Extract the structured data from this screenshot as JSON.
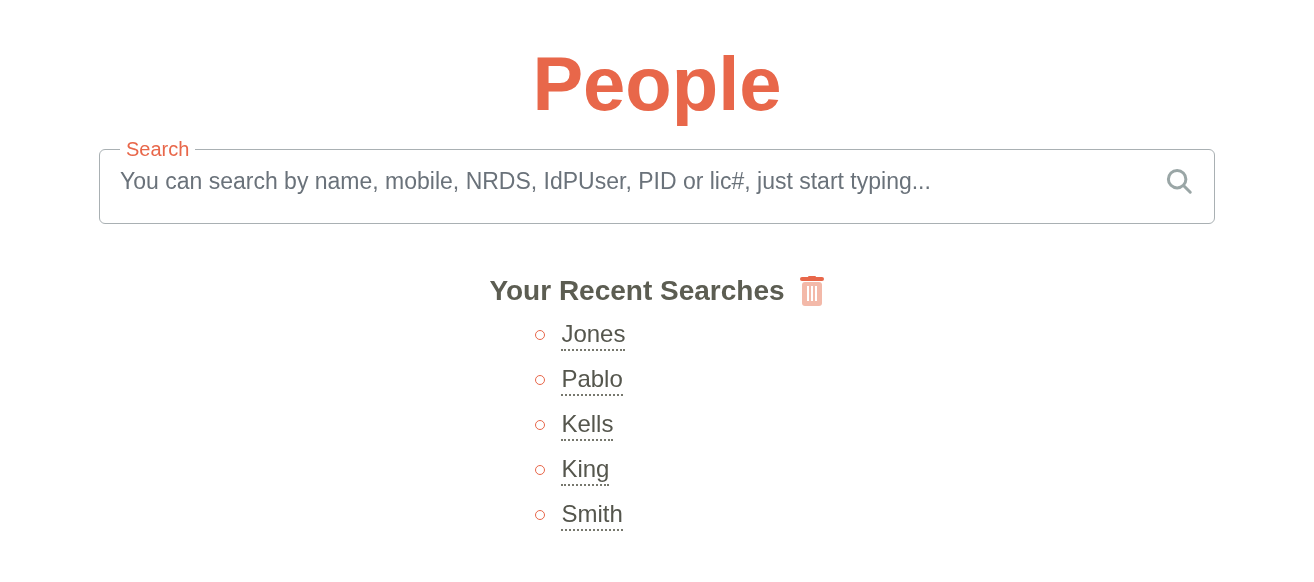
{
  "title": "People",
  "search": {
    "label": "Search",
    "placeholder": "You can search by name, mobile, NRDS, IdPUser, PID or lic#, just start typing..."
  },
  "recent": {
    "heading": "Your Recent Searches",
    "items": [
      "Jones",
      "Pablo",
      "Kells",
      "King",
      "Smith"
    ]
  }
}
